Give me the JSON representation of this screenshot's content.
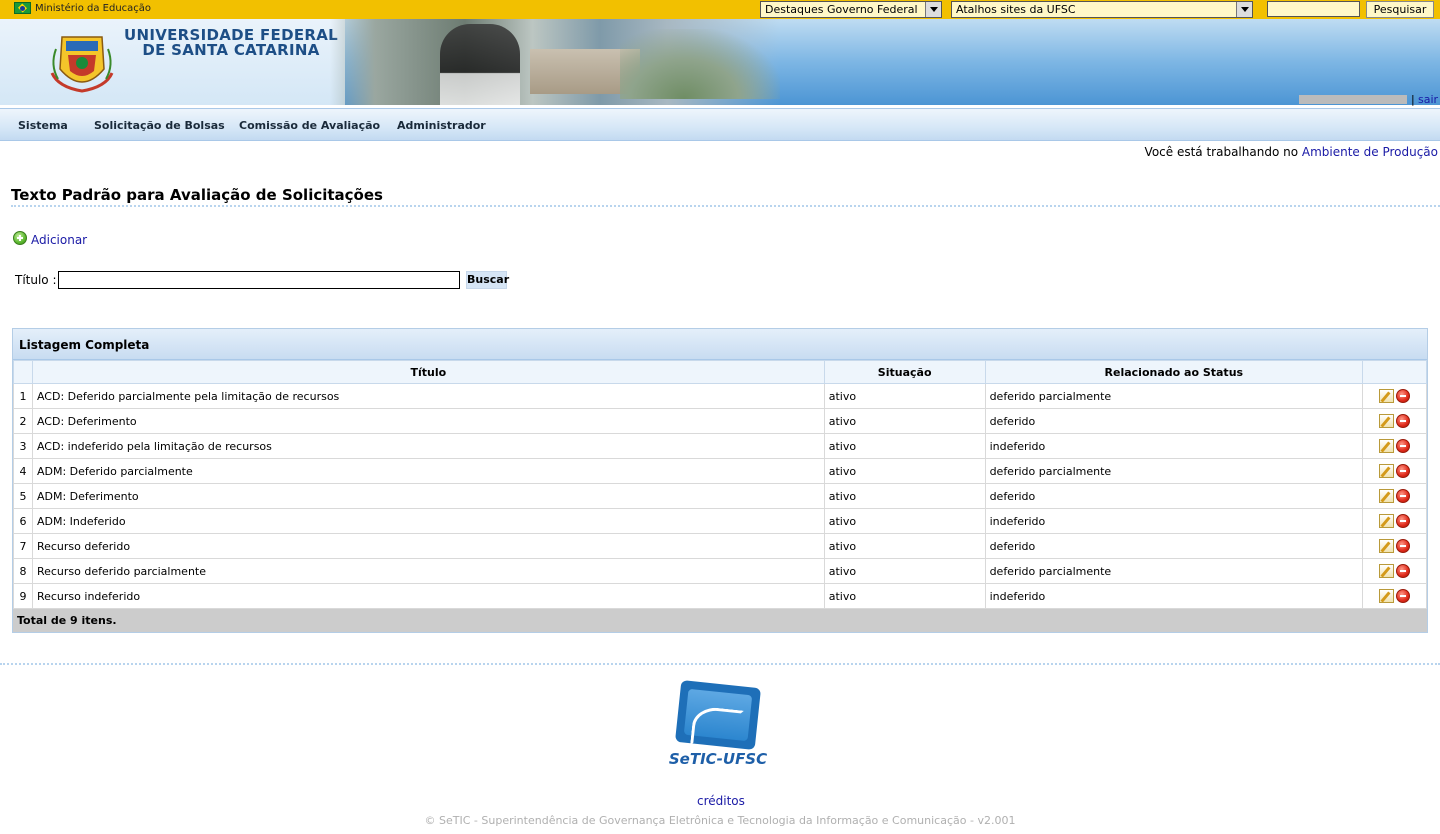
{
  "gov_bar": {
    "ministry": "Ministério da Educação",
    "select_federal": "Destaques Governo Federal",
    "select_ufsc": "Atalhos sites da UFSC",
    "search_button": "Pesquisar"
  },
  "header": {
    "university_line1": "UNIVERSIDADE FEDERAL",
    "university_line2": "DE SANTA CATARINA",
    "logout": "sair",
    "separator": "|"
  },
  "nav": {
    "items": [
      {
        "label": "Sistema"
      },
      {
        "label": "Solicitação de Bolsas"
      },
      {
        "label": "Comissão de Avaliação"
      },
      {
        "label": "Administrador"
      }
    ]
  },
  "env": {
    "prefix": "Você está trabalhando no",
    "link": "Ambiente de Produção"
  },
  "page": {
    "title": "Texto Padrão para Avaliação de Solicitações",
    "add_label": "Adicionar",
    "filter_label": "Título :",
    "filter_value": "",
    "search_button": "Buscar"
  },
  "table": {
    "caption": "Listagem Completa",
    "columns": [
      "",
      "Título",
      "Situação",
      "Relacionado ao Status",
      ""
    ],
    "rows": [
      {
        "num": "1",
        "title": "ACD: Deferido parcialmente pela limitação de recursos",
        "situacao": "ativo",
        "status": "deferido parcialmente"
      },
      {
        "num": "2",
        "title": "ACD: Deferimento",
        "situacao": "ativo",
        "status": "deferido"
      },
      {
        "num": "3",
        "title": "ACD: indeferido pela limitação de recursos",
        "situacao": "ativo",
        "status": "indeferido"
      },
      {
        "num": "4",
        "title": "ADM: Deferido parcialmente",
        "situacao": "ativo",
        "status": "deferido parcialmente"
      },
      {
        "num": "5",
        "title": "ADM: Deferimento",
        "situacao": "ativo",
        "status": "deferido"
      },
      {
        "num": "6",
        "title": "ADM: Indeferido",
        "situacao": "ativo",
        "status": "indeferido"
      },
      {
        "num": "7",
        "title": "Recurso deferido",
        "situacao": "ativo",
        "status": "deferido"
      },
      {
        "num": "8",
        "title": "Recurso deferido parcialmente",
        "situacao": "ativo",
        "status": "deferido parcialmente"
      },
      {
        "num": "9",
        "title": "Recurso indeferido",
        "situacao": "ativo",
        "status": "indeferido"
      }
    ],
    "footer": "Total de 9 itens."
  },
  "footer": {
    "logo_text": "SeTIC-UFSC",
    "credits": "créditos",
    "copyright": "© SeTIC - Superintendência de Governança Eletrônica e Tecnologia da Informação e Comunicação - v2.001"
  },
  "colors": {
    "gov_bar": "#f2c000",
    "link": "#1a1aa6",
    "accent_blue": "#1e6fb8"
  },
  "icons": {
    "flag": "brazil-flag-icon",
    "add": "add-icon",
    "edit": "edit-icon",
    "delete": "delete-icon"
  }
}
